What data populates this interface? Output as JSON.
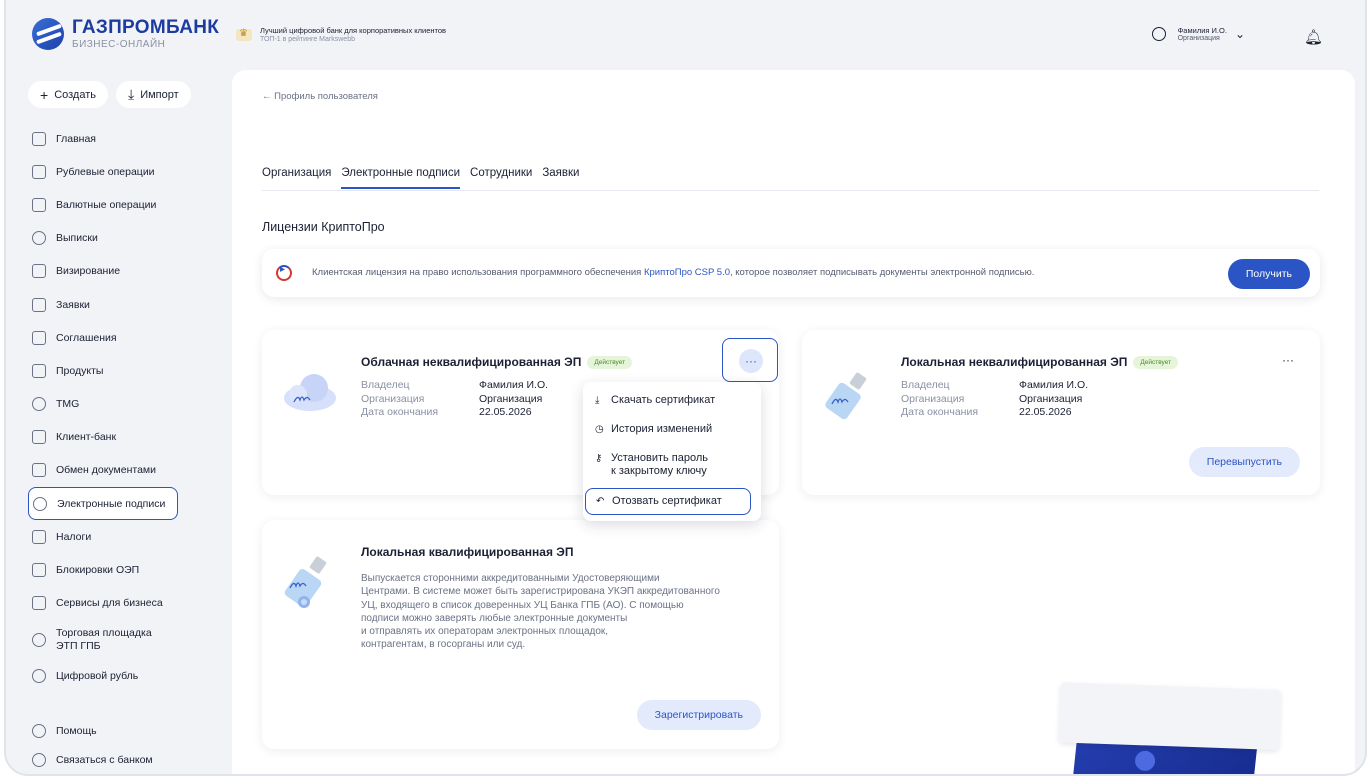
{
  "brand": {
    "name": "ГАЗПРОМБАНК",
    "subtitle": "БИЗНЕС-ОНЛАЙН"
  },
  "promo": {
    "title": "Лучший цифровой банк для корпоративных клиентов",
    "subtitle": "ТОП-1 в рейтинге Markswebb"
  },
  "user": {
    "name": "Фамилия И.О.",
    "org": "Организация"
  },
  "actions": {
    "create": "Создать",
    "import": "Импорт"
  },
  "nav": {
    "items": [
      {
        "label": "Главная"
      },
      {
        "label": "Рублевые операции"
      },
      {
        "label": "Валютные операции"
      },
      {
        "label": "Выписки"
      },
      {
        "label": "Визирование"
      },
      {
        "label": "Заявки"
      },
      {
        "label": "Соглашения"
      },
      {
        "label": "Продукты"
      },
      {
        "label": "TMG"
      },
      {
        "label": "Клиент-банк"
      },
      {
        "label": "Обмен документами"
      },
      {
        "label": "Электронные подписи"
      },
      {
        "label": "Налоги"
      },
      {
        "label": "Блокировки ОЭП"
      },
      {
        "label": "Сервисы для бизнеса"
      },
      {
        "label": "Торговая площадка",
        "label2": "ЭТП ГПБ"
      },
      {
        "label": "Цифровой рубль"
      }
    ],
    "help": "Помощь",
    "contact": "Связаться с банком"
  },
  "page": {
    "back": "← Профиль пользователя",
    "tabs": [
      "Организация",
      "Электронные подписи",
      "Сотрудники",
      "Заявки"
    ],
    "section_title": "Лицензии КриптоПро",
    "license": {
      "text_before": "Клиентская лицензия на право использования программного обеспечения ",
      "link": "КриптоПро CSP 5.0",
      "text_after": ", которое позволяет подписывать документы электронной подписью.",
      "button": "Получить"
    }
  },
  "cards": {
    "cloud": {
      "title": "Облачная неквалифицированная ЭП",
      "badge": "Действует",
      "owner_label": "Владелец",
      "owner": "Фамилия И.О.",
      "org_label": "Организация",
      "org": "Организация",
      "date_label": "Дата окончания",
      "date": "22.05.2026",
      "more": "···"
    },
    "local": {
      "title": "Локальная неквалифицированная ЭП",
      "badge": "Действует",
      "owner_label": "Владелец",
      "owner": "Фамилия И.О.",
      "org_label": "Организация",
      "org": "Организация",
      "date_label": "Дата окончания",
      "date": "22.05.2026",
      "more": "···",
      "button": "Перевыпустить"
    },
    "qualified": {
      "title": "Локальная квалифицированная ЭП",
      "desc": [
        "Выпускается сторонними аккредитованными Удостоверяющими",
        "Центрами. В системе может быть зарегистрирована УКЭП аккредитованного",
        "УЦ, входящего в список доверенных УЦ Банка ГПБ (АО). С помощью",
        "подписи можно заверять любые электронные документы",
        "и отправлять их операторам электронных площадок,",
        "контрагентам, в госорганы или суд."
      ],
      "button": "Зарегистрировать"
    }
  },
  "menu": {
    "download": "Скачать сертификат",
    "history": "История изменений",
    "password1": "Установить пароль",
    "password2": "к закрытому ключу",
    "revoke": "Отозвать сертификат"
  },
  "colors": {
    "accent": "#2b55c5",
    "badge_bg": "#e6f5da",
    "badge_text": "#4a8a2a"
  }
}
